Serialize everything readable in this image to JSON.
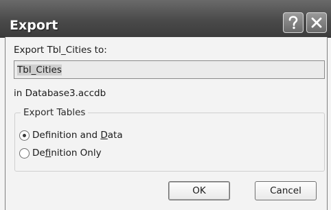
{
  "window": {
    "title": "Export",
    "help_icon": "question-mark-icon",
    "close_icon": "close-x-icon"
  },
  "form": {
    "export_label": "Export Tbl_Cities to:",
    "name_value": "Tbl_Cities",
    "database_label": "in Database3.accdb"
  },
  "export_tables": {
    "group_title": "Export Tables",
    "options": [
      {
        "before": "Definition and ",
        "mnemonic": "D",
        "after": "ata",
        "selected": true
      },
      {
        "before": "De",
        "mnemonic": "f",
        "after": "inition Only",
        "selected": false
      }
    ]
  },
  "buttons": {
    "ok": "OK",
    "cancel": "Cancel"
  },
  "colors": {
    "titlebar": "#4a4a4a",
    "client_bg": "#f3f3f3",
    "input_bg": "#ebebeb"
  }
}
